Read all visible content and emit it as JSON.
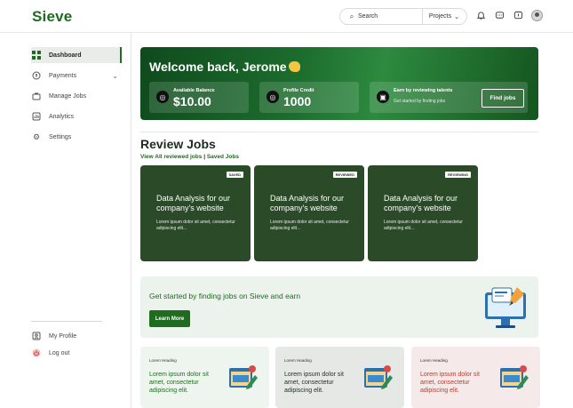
{
  "header": {
    "logo": "Sieve",
    "search_placeholder": "Search",
    "projects_label": "Projects",
    "icons": [
      "bell-icon",
      "chat-icon",
      "message-icon",
      "avatar"
    ]
  },
  "sidebar": {
    "items": [
      {
        "label": "Dashboard",
        "icon": "grid-icon",
        "active": true
      },
      {
        "label": "Payments",
        "icon": "wallet-icon",
        "has_chevron": true
      },
      {
        "label": "Manage Jobs",
        "icon": "briefcase-icon"
      },
      {
        "label": "Analytics",
        "icon": "analytics-icon"
      },
      {
        "label": "Settings",
        "icon": "gear-icon"
      }
    ],
    "bottom_items": [
      {
        "label": "My Profile",
        "icon": "profile-icon"
      },
      {
        "label": "Log out",
        "icon": "logout-icon"
      }
    ]
  },
  "banner": {
    "welcome": "Welcome back, Jerome",
    "balance_label": "Available Balance",
    "balance_value": "$10.00",
    "credit_label": "Profile Credit",
    "credit_value": "1000",
    "earn_title": "Earn by reviewing talents",
    "earn_sub": "Get started by finding jobs",
    "find_jobs": "Find jobs"
  },
  "review": {
    "title": "Review Jobs",
    "link_all": "View All reviewed jobs",
    "separator": "|",
    "link_saved": "Saved Jobs",
    "cards": [
      {
        "badge": "SAVED",
        "title": "Data Analysis for our company's website",
        "desc": "Lorem ipsum dolor sit amet, consectetur adipiscing elit..."
      },
      {
        "badge": "REVIEWED",
        "title": "Data Analysis for our company's website",
        "desc": "Lorem ipsum dolor sit amet, consectetur adipiscing elit..."
      },
      {
        "badge": "REVIEWING",
        "title": "Data Analysis for our company's website",
        "desc": "Lorem ipsum dolor sit amet, consectetur adipiscing elit..."
      }
    ]
  },
  "promo": {
    "text": "Get started by finding jobs on Sieve and earn",
    "button": "Learn More"
  },
  "mini_cards": [
    {
      "heading": "Lorem Heading",
      "text": "Lorem ipsum dolor sit amet, consectetur adipiscing elit.",
      "bg": "#eef5ee",
      "color": "#1f6b1f"
    },
    {
      "heading": "Lorem Heading",
      "text": "Lorem ipsum dolor sit amet, consectetur adipiscing elit.",
      "bg": "#e6e8e6",
      "color": "#1f2a1f"
    },
    {
      "heading": "Lorem Heading",
      "text": "Lorem ipsum dolor sit amet, consectetur adipiscing elit.",
      "bg": "#f5e9e9",
      "color": "#c0392b"
    }
  ],
  "colors": {
    "brand": "#1f6b1f",
    "banner": "#1d6d2e",
    "card": "#2a4a28"
  }
}
